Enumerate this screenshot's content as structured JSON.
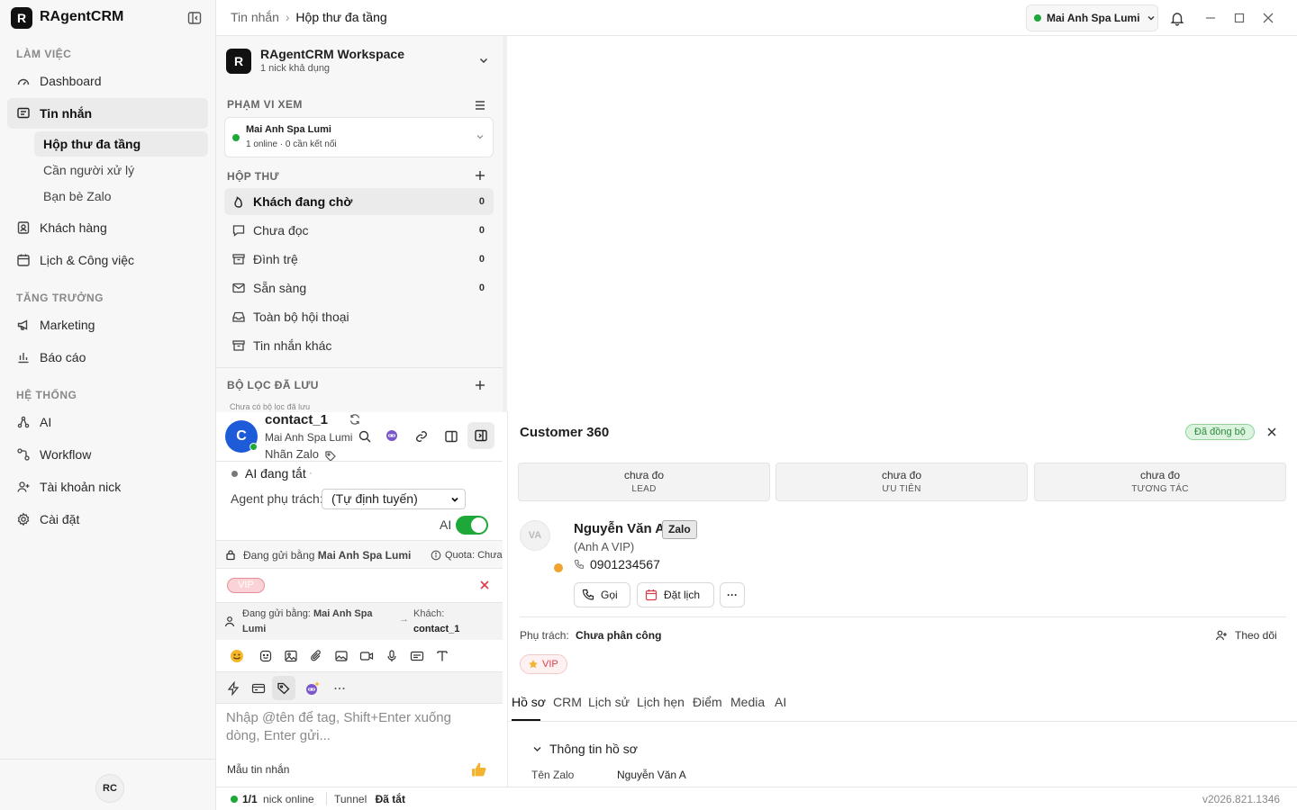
{
  "app": {
    "name": "RAgentCRM",
    "logo_letter": "R"
  },
  "sidebar": {
    "sections": [
      {
        "title": "LÀM VIỆC"
      },
      {
        "title": "TĂNG TRƯỞNG"
      },
      {
        "title": "HỆ THỐNG"
      }
    ],
    "items": {
      "dashboard": "Dashboard",
      "messages": "Tin nhắn",
      "customers": "Khách hàng",
      "calendar": "Lịch & Công việc",
      "marketing": "Marketing",
      "reports": "Báo cáo",
      "ai": "AI",
      "workflow": "Workflow",
      "nick_accounts": "Tài khoản nick",
      "settings": "Cài đặt"
    },
    "sub_items": {
      "multi_inbox": "Hộp thư đa tầng",
      "needs_handler": "Cần người xử lý",
      "zalo_friends": "Bạn bè Zalo"
    },
    "user_initials": "RC"
  },
  "topbar": {
    "breadcrumb_root": "Tin nhắn",
    "breadcrumb_sep": "›",
    "breadcrumb_current": "Hộp thư đa tầng",
    "account": "Mai Anh Spa Lumi"
  },
  "inbox": {
    "workspace_name": "RAgentCRM Workspace",
    "workspace_sub": "1 nick khả dụng",
    "scope_title": "PHẠM VI XEM",
    "scope_account": "Mai Anh Spa Lumi",
    "scope_status": "1 online · 0 cần kết nối",
    "mailbox_title": "HỘP THƯ",
    "items": [
      {
        "label": "Khách đang chờ",
        "count": "0"
      },
      {
        "label": "Chưa đọc",
        "count": "0"
      },
      {
        "label": "Đình trệ",
        "count": "0"
      },
      {
        "label": "Sẵn sàng",
        "count": "0"
      },
      {
        "label": "Toàn bộ hội thoại",
        "count": ""
      },
      {
        "label": "Tin nhắn khác",
        "count": ""
      }
    ],
    "saved_filters_title": "BỘ LỌC ĐÃ LƯU",
    "saved_filters_empty": "Chưa có bộ lọc đã lưu"
  },
  "conversation": {
    "avatar_letter": "C",
    "name": "contact_1",
    "account": "Mai Anh Spa Lumi",
    "tag_label": "Nhãn Zalo",
    "ai_status": "AI đang tắt",
    "ai_status_suffix": "·",
    "agent_label": "Agent phụ trách:",
    "agent_value": "(Tự định tuyến)",
    "ai_toggle_label": "AI",
    "sending_via_prefix": "Đang gửi bằng",
    "sending_via_account": "Mai Anh Spa Lumi",
    "quota": "Quota: Chưa",
    "vip_tag": "VIP",
    "composer_from_prefix": "Đang gửi bằng:",
    "composer_from_account": "Mai Anh Spa Lumi",
    "composer_arrow": "→",
    "composer_to_prefix": "Khách:",
    "composer_to": "contact_1",
    "placeholder": "Nhập @tên để tag, Shift+Enter xuống dòng, Enter gửi...",
    "template_label": "Mẫu tin nhắn"
  },
  "customer360": {
    "title": "Customer 360",
    "sync_badge": "Đã đồng bộ",
    "metrics": [
      {
        "value": "chưa đo",
        "label": "LEAD"
      },
      {
        "value": "chưa đo",
        "label": "ƯU TIÊN"
      },
      {
        "value": "chưa đo",
        "label": "TƯƠNG TÁC"
      }
    ],
    "avatar_initials": "VA",
    "name": "Nguyễn Văn A",
    "channel_badge": "Zalo",
    "alias": "(Anh A VIP)",
    "phone": "0901234567",
    "call_label": "Gọi",
    "schedule_label": "Đặt lịch",
    "more_label": "···",
    "owner_label": "Phụ trách:",
    "owner_value": "Chưa phân công",
    "follow_label": "Theo dõi",
    "vip_tag": "VIP",
    "tabs": [
      "Hồ sơ",
      "CRM",
      "Lịch sử",
      "Lịch hẹn",
      "Điểm",
      "Media",
      "AI"
    ],
    "section_title": "Thông tin hồ sơ",
    "field_label": "Tên Zalo",
    "field_value": "Nguyễn Văn A"
  },
  "statusbar": {
    "online_count": "1/1",
    "online_label": "nick online",
    "tunnel_label": "Tunnel",
    "tunnel_value": "Đã tắt",
    "version": "v2026.821.1346"
  },
  "colors": {
    "accent_green": "#1fa83a",
    "avatar_blue": "#1e5bd8",
    "vip_red": "#e0404f",
    "sync_green": "#2e8b3d"
  }
}
